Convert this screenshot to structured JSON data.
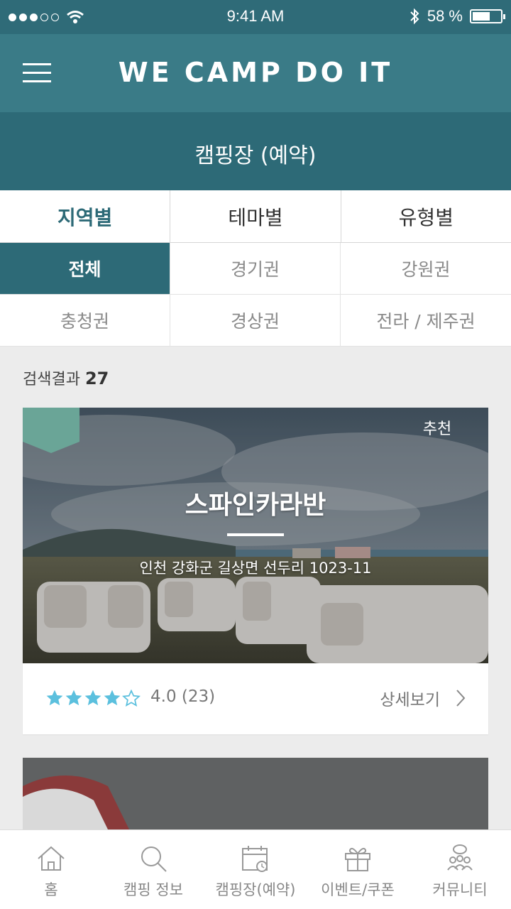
{
  "status": {
    "time": "9:41 AM",
    "battery": "58 %",
    "battery_level": 0.58
  },
  "header": {
    "title": "WE CAMP DO IT",
    "menu_icon": "hamburger-menu-icon"
  },
  "page": {
    "title": "캠핑장 (예약)"
  },
  "tabs": [
    {
      "label": "지역별",
      "active": true
    },
    {
      "label": "테마별",
      "active": false
    },
    {
      "label": "유형별",
      "active": false
    }
  ],
  "regions": [
    {
      "label": "전체",
      "active": true
    },
    {
      "label": "경기권",
      "active": false
    },
    {
      "label": "강원권",
      "active": false
    },
    {
      "label": "충청권",
      "active": false
    },
    {
      "label": "경상권",
      "active": false
    },
    {
      "label": "전라 / 제주권",
      "active": false
    }
  ],
  "result": {
    "label": "검색결과",
    "count": "27"
  },
  "cards": [
    {
      "badge": "추천",
      "name": "스파인카라반",
      "address": "인천 강화군 길상면 선두리 1023-11",
      "rating_value": 4.0,
      "rating_text": "4.0 (23)",
      "detail_label": "상세보기"
    }
  ],
  "colors": {
    "primary": "#2d6a77",
    "header": "#3a7b87",
    "star": "#5bc0de",
    "badge": "#6aa597"
  },
  "nav": [
    {
      "label": "홈",
      "icon": "home-icon"
    },
    {
      "label": "캠핑 정보",
      "icon": "search-icon"
    },
    {
      "label": "캠핑장(예약)",
      "icon": "calendar-icon"
    },
    {
      "label": "이벤트/쿠폰",
      "icon": "gift-icon"
    },
    {
      "label": "커뮤니티",
      "icon": "community-icon"
    }
  ]
}
